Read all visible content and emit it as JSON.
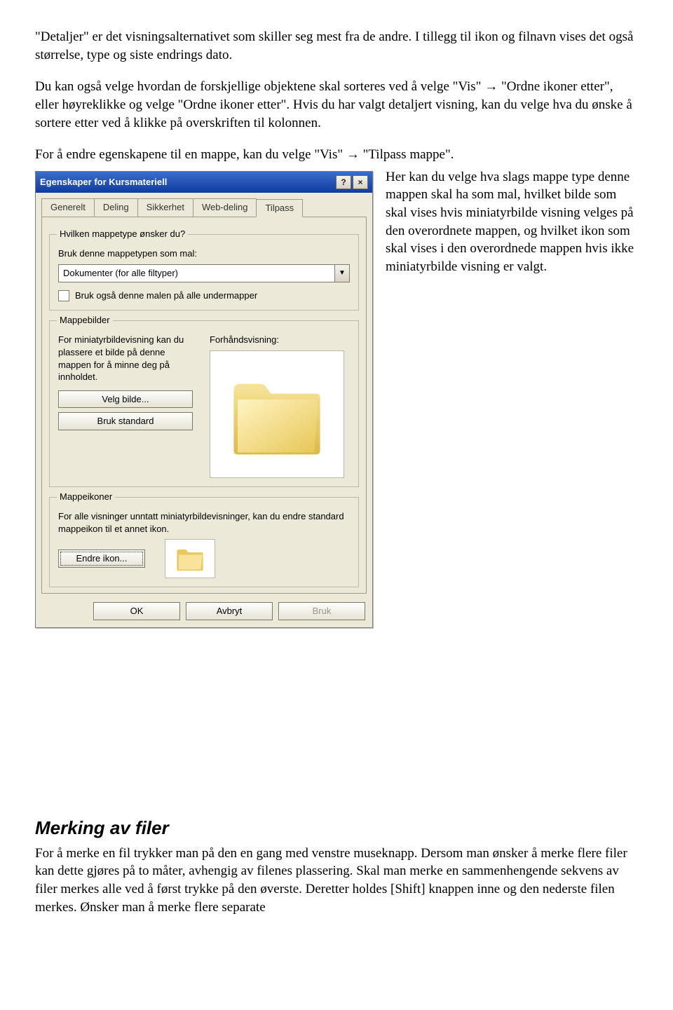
{
  "para1": "\"Detaljer\" er det visningsalternativet som skiller seg mest fra de andre. I tillegg til ikon og filnavn vises det også størrelse, type og siste endrings dato.",
  "para2_a": "Du kan også velge hvordan de forskjellige objektene skal sorteres ved å velge \"Vis\" ",
  "para2_b": " \"Ordne ikoner etter\", eller høyreklikke og velge \"Ordne ikoner etter\". Hvis du har valgt detaljert visning, kan du velge hva du ønske å sortere etter ved å klikke på overskriften til kolonnen.",
  "para3_a": "For å endre egenskapene til en mappe, kan du velge \"Vis\" ",
  "para3_b": " \"Tilpass mappe\".",
  "arrow": "→",
  "side_para": "Her kan du velge hva slags mappe type denne mappen skal ha som mal, hvilket bilde som skal vises hvis miniatyrbilde visning velges på den overordnete mappen, og hvilket ikon som skal vises i den overordnede mappen hvis ikke miniatyrbilde visning er valgt.",
  "dialog": {
    "title": "Egenskaper for Kursmateriell",
    "tabs": [
      "Generelt",
      "Deling",
      "Sikkerhet",
      "Web-deling",
      "Tilpass"
    ],
    "group1": {
      "legend": "Hvilken mappetype ønsker du?",
      "label_use": "Bruk denne mappetypen som mal:",
      "dropdown": "Dokumenter (for alle filtyper)",
      "checkbox_label": "Bruk også denne malen på alle undermapper"
    },
    "group2": {
      "legend": "Mappebilder",
      "desc": "For miniatyrbildevisning kan du plassere et bilde på denne mappen for å minne deg på innholdet.",
      "preview_label": "Forhåndsvisning:",
      "btn_choose": "Velg bilde...",
      "btn_standard": "Bruk standard"
    },
    "group3": {
      "legend": "Mappeikoner",
      "desc": "For alle visninger unntatt miniatyrbildevisninger, kan du endre standard mappeikon til et annet ikon.",
      "btn_change": "Endre ikon..."
    },
    "buttons": {
      "ok": "OK",
      "cancel": "Avbryt",
      "apply": "Bruk"
    }
  },
  "section_title": "Merking av filer",
  "section_body": "For å merke en fil trykker man på den en gang med venstre museknapp. Dersom man ønsker å merke flere filer kan dette gjøres på to måter, avhengig av filenes plassering. Skal man merke en sammenhengende sekvens av filer merkes alle ved å først trykke på den øverste. Deretter holdes [Shift] knappen inne og den nederste filen merkes. Ønsker man å merke flere separate"
}
